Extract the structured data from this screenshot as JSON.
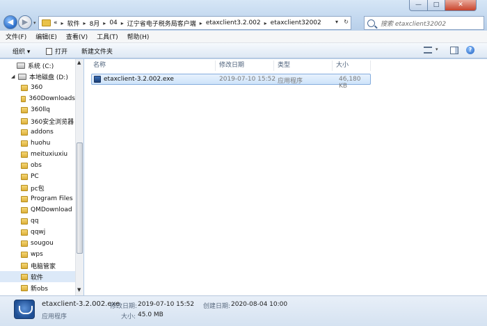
{
  "address_bar": {
    "prefix": "«",
    "crumbs": [
      "软件",
      "8月",
      "04",
      "辽宁省电子税务局客户端",
      "etaxclient3.2.002",
      "etaxclient32002"
    ]
  },
  "search": {
    "placeholder": "搜索 etaxclient32002"
  },
  "window_buttons": {
    "minimize": "—",
    "maximize": "□",
    "close": "✕"
  },
  "menu": [
    "文件(F)",
    "编辑(E)",
    "查看(V)",
    "工具(T)",
    "帮助(H)"
  ],
  "toolbar": {
    "organize": "组织 ▾",
    "open": "打开",
    "new_folder": "新建文件夹"
  },
  "nav_tree": [
    {
      "label": "系统 (C:)",
      "kind": "drive"
    },
    {
      "label": "本地磁盘 (D:)",
      "kind": "drive"
    },
    {
      "label": "360",
      "kind": "folder"
    },
    {
      "label": "360Downloads",
      "kind": "folder"
    },
    {
      "label": "360llq",
      "kind": "folder"
    },
    {
      "label": "360安全浏览器",
      "kind": "folder"
    },
    {
      "label": "addons",
      "kind": "folder"
    },
    {
      "label": "huohu",
      "kind": "folder"
    },
    {
      "label": "meituxiuxiu",
      "kind": "folder"
    },
    {
      "label": "obs",
      "kind": "folder"
    },
    {
      "label": "PC",
      "kind": "folder"
    },
    {
      "label": "pc包",
      "kind": "folder"
    },
    {
      "label": "Program Files",
      "kind": "folder"
    },
    {
      "label": "QMDownload",
      "kind": "folder"
    },
    {
      "label": "qq",
      "kind": "folder"
    },
    {
      "label": "qqwj",
      "kind": "folder"
    },
    {
      "label": "sougou",
      "kind": "folder"
    },
    {
      "label": "wps",
      "kind": "folder"
    },
    {
      "label": "电脑管家",
      "kind": "folder"
    },
    {
      "label": "软件",
      "kind": "folder",
      "selected": true
    },
    {
      "label": "新obs",
      "kind": "folder"
    }
  ],
  "columns": {
    "name": "名称",
    "date": "修改日期",
    "type": "类型",
    "size": "大小"
  },
  "file": {
    "name": "etaxclient-3.2.002.exe",
    "date": "2019-07-10 15:52",
    "type": "应用程序",
    "size": "46,180 KB"
  },
  "details": {
    "name": "etaxclient-3.2.002.exe",
    "type": "应用程序",
    "modified_label": "修改日期:",
    "modified_value": "2019-07-10 15:52",
    "created_label": "创建日期:",
    "created_value": "2020-08-04 10:00",
    "size_label": "大小:",
    "size_value": "45.0 MB"
  }
}
